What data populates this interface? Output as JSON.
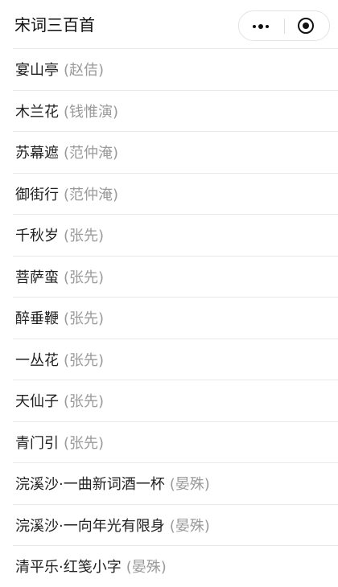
{
  "nav": {
    "title": "宋词三百首"
  },
  "capsule": {
    "more_icon": "more-dots-icon",
    "close_icon": "target-circle-icon"
  },
  "poems": [
    {
      "title": "宴山亭",
      "author": "(赵佶)"
    },
    {
      "title": "木兰花",
      "author": "(钱惟演)"
    },
    {
      "title": "苏幕遮",
      "author": "(范仲淹)"
    },
    {
      "title": "御街行",
      "author": "(范仲淹)"
    },
    {
      "title": "千秋岁",
      "author": "(张先)"
    },
    {
      "title": "菩萨蛮",
      "author": "(张先)"
    },
    {
      "title": "醉垂鞭",
      "author": "(张先)"
    },
    {
      "title": "一丛花",
      "author": "(张先)"
    },
    {
      "title": "天仙子",
      "author": "(张先)"
    },
    {
      "title": "青门引",
      "author": "(张先)"
    },
    {
      "title": "浣溪沙·一曲新词酒一杯",
      "author": "(晏殊)"
    },
    {
      "title": "浣溪沙·一向年光有限身",
      "author": "(晏殊)"
    },
    {
      "title": "清平乐·红笺小字",
      "author": "(晏殊)"
    }
  ],
  "colors": {
    "background": "#ffffff",
    "title_text": "#1f1f1f",
    "author_text": "#9a9a9a",
    "divider": "#e8e8e8"
  }
}
